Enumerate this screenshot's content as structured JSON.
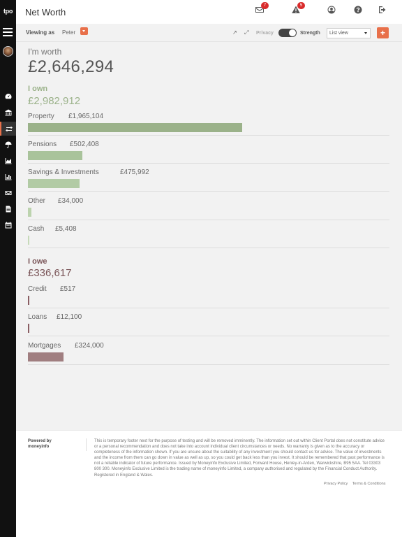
{
  "app": {
    "logo": "tpo"
  },
  "header": {
    "title": "Net Worth",
    "messages_badge": "7",
    "alerts_badge": "5"
  },
  "toolbar": {
    "viewing_as_label": "Viewing as",
    "viewer_name": "Peter",
    "privacy_label": "Privacy",
    "strength_label": "Strength",
    "view_select_value": "List view",
    "add_button": "+"
  },
  "summary": {
    "worth_label": "I'm worth",
    "worth_value": "£2,646,294"
  },
  "assets": {
    "label": "I own",
    "total": "£2,982,912",
    "color": "#9bb28a",
    "items": [
      {
        "label": "Property",
        "value": "£1,965,104",
        "amount": 1965104,
        "color": "#9bb28a"
      },
      {
        "label": "Pensions",
        "value": "£502,408",
        "amount": 502408,
        "color": "#a9c39b"
      },
      {
        "label": "Savings & Investments",
        "value": "£475,992",
        "amount": 475992,
        "color": "#b2cba5"
      },
      {
        "label": "Other",
        "value": "£34,000",
        "amount": 34000,
        "color": "#bcd3ae"
      },
      {
        "label": "Cash",
        "value": "£5,408",
        "amount": 5408,
        "color": "#c6dab9"
      }
    ]
  },
  "liabilities": {
    "label": "I owe",
    "total": "£336,617",
    "color": "#7a5558",
    "items": [
      {
        "label": "Credit",
        "value": "£517",
        "amount": 517,
        "color": "#8a5e63"
      },
      {
        "label": "Loans",
        "value": "£12,100",
        "amount": 12100,
        "color": "#8a5e63"
      },
      {
        "label": "Mortgages",
        "value": "£324,000",
        "amount": 324000,
        "color": "#a07e80"
      }
    ]
  },
  "footer": {
    "powered_by": "Powered by moneyinfo",
    "disclaimer": "This is temporary footer next for the purpose of testing and will be removed imminently. The information set out within Client Portal does not constitute advice or a personal recommendation and does not take into account individual client circumstances or needs. No warranty is given as to the accuracy or completeness of the information shown. If you are unsure about the suitability of any investment you should contact us for advice. The value of investments and the income from them can go down in value as well as up, so you could get back less than you invest. It should be remembered that past performance is not a reliable indicator of future performance. Issued by Moneyinfo Exclusive Limited, Forward House, Henley-in-Arden, Warwickshire, B95 5AA. Tel 03303 800 300. Moneyinfo Exclusive Limited is the trading name of moneyinfo Limited, a company authorised and regulated by the Financial Conduct Authority. Registered in England & Wales.",
    "privacy_policy": "Privacy Policy",
    "terms": "Terms & Conditions"
  },
  "icons": {
    "sidebar": [
      "dashboard-icon",
      "bank-icon",
      "transfer-icon",
      "umbrella-icon",
      "area-chart-icon",
      "bar-chart-icon",
      "envelope-icon",
      "document-icon",
      "calendar-icon"
    ],
    "header": [
      "envelope-icon",
      "warning-icon",
      "user-icon",
      "help-icon",
      "sign-out-icon"
    ]
  }
}
